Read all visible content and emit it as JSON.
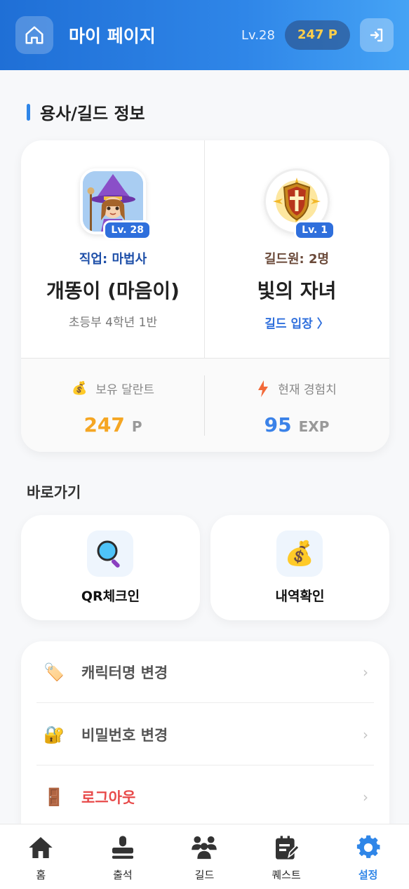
{
  "header": {
    "title": "마이 페이지",
    "level": "Lv.28",
    "points": "247 P"
  },
  "section_title": "용사/길드 정보",
  "hero": {
    "level_badge": "Lv. 28",
    "job": "직업: 마법사",
    "name": "개똥이 (마음이)",
    "school": "초등부 4학년 1반"
  },
  "guild": {
    "level_badge": "Lv. 1",
    "members": "길드원: 2명",
    "name": "빛의 자녀",
    "enter_link": "길드 입장 〉"
  },
  "stats": {
    "talent_label": "보유 달란트",
    "talent_value": "247",
    "talent_unit": "P",
    "exp_label": "현재 경험치",
    "exp_value": "95",
    "exp_unit": "EXP"
  },
  "shortcuts": {
    "title": "바로가기",
    "qr_label": "QR체크인",
    "history_label": "내역확인"
  },
  "menu": {
    "rename_label": "캐릭터명 변경",
    "password_label": "비밀번호 변경",
    "logout_label": "로그아웃",
    "chevron": "›"
  },
  "nav": {
    "home": "홈",
    "attendance": "출석",
    "guild": "길드",
    "quest": "퀘스트",
    "settings": "설정"
  },
  "colors": {
    "accent": "#2f86e8",
    "points_gold": "#f5a623",
    "exp_blue": "#3b82e8",
    "danger": "#e84a4a"
  }
}
